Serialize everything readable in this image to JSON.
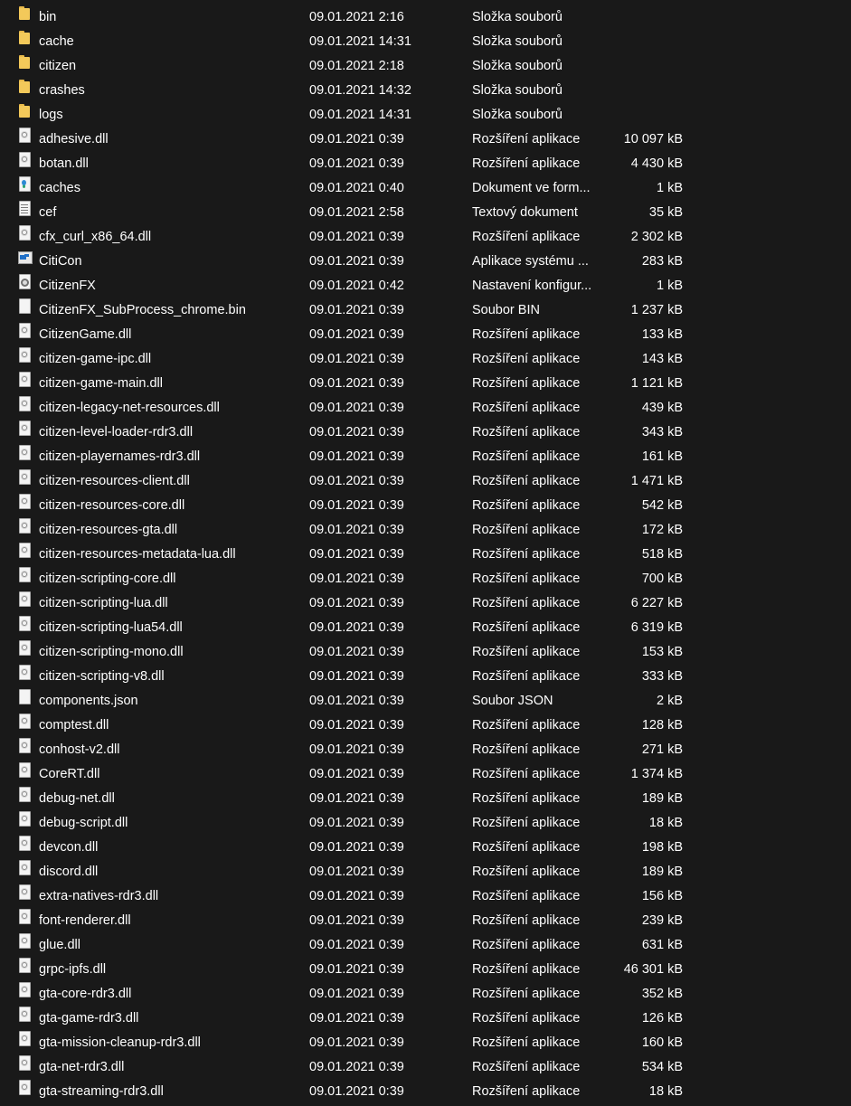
{
  "files": [
    {
      "name": "bin",
      "date": "09.01.2021 2:16",
      "type": "Složka souborů",
      "size": "",
      "icon": "folder"
    },
    {
      "name": "cache",
      "date": "09.01.2021 14:31",
      "type": "Složka souborů",
      "size": "",
      "icon": "folder"
    },
    {
      "name": "citizen",
      "date": "09.01.2021 2:18",
      "type": "Složka souborů",
      "size": "",
      "icon": "folder"
    },
    {
      "name": "crashes",
      "date": "09.01.2021 14:32",
      "type": "Složka souborů",
      "size": "",
      "icon": "folder"
    },
    {
      "name": "logs",
      "date": "09.01.2021 14:31",
      "type": "Složka souborů",
      "size": "",
      "icon": "folder"
    },
    {
      "name": "adhesive.dll",
      "date": "09.01.2021 0:39",
      "type": "Rozšíření aplikace",
      "size": "10 097 kB",
      "icon": "dll"
    },
    {
      "name": "botan.dll",
      "date": "09.01.2021 0:39",
      "type": "Rozšíření aplikace",
      "size": "4 430 kB",
      "icon": "dll"
    },
    {
      "name": "caches",
      "date": "09.01.2021 0:40",
      "type": "Dokument ve form...",
      "size": "1 kB",
      "icon": "doc"
    },
    {
      "name": "cef",
      "date": "09.01.2021 2:58",
      "type": "Textový dokument",
      "size": "35 kB",
      "icon": "txt"
    },
    {
      "name": "cfx_curl_x86_64.dll",
      "date": "09.01.2021 0:39",
      "type": "Rozšíření aplikace",
      "size": "2 302 kB",
      "icon": "dll"
    },
    {
      "name": "CitiCon",
      "date": "09.01.2021 0:39",
      "type": "Aplikace systému ...",
      "size": "283 kB",
      "icon": "exe"
    },
    {
      "name": "CitizenFX",
      "date": "09.01.2021 0:42",
      "type": "Nastavení konfigur...",
      "size": "1 kB",
      "icon": "settings"
    },
    {
      "name": "CitizenFX_SubProcess_chrome.bin",
      "date": "09.01.2021 0:39",
      "type": "Soubor BIN",
      "size": "1 237 kB",
      "icon": "blank"
    },
    {
      "name": "CitizenGame.dll",
      "date": "09.01.2021 0:39",
      "type": "Rozšíření aplikace",
      "size": "133 kB",
      "icon": "dll"
    },
    {
      "name": "citizen-game-ipc.dll",
      "date": "09.01.2021 0:39",
      "type": "Rozšíření aplikace",
      "size": "143 kB",
      "icon": "dll"
    },
    {
      "name": "citizen-game-main.dll",
      "date": "09.01.2021 0:39",
      "type": "Rozšíření aplikace",
      "size": "1 121 kB",
      "icon": "dll"
    },
    {
      "name": "citizen-legacy-net-resources.dll",
      "date": "09.01.2021 0:39",
      "type": "Rozšíření aplikace",
      "size": "439 kB",
      "icon": "dll"
    },
    {
      "name": "citizen-level-loader-rdr3.dll",
      "date": "09.01.2021 0:39",
      "type": "Rozšíření aplikace",
      "size": "343 kB",
      "icon": "dll"
    },
    {
      "name": "citizen-playernames-rdr3.dll",
      "date": "09.01.2021 0:39",
      "type": "Rozšíření aplikace",
      "size": "161 kB",
      "icon": "dll"
    },
    {
      "name": "citizen-resources-client.dll",
      "date": "09.01.2021 0:39",
      "type": "Rozšíření aplikace",
      "size": "1 471 kB",
      "icon": "dll"
    },
    {
      "name": "citizen-resources-core.dll",
      "date": "09.01.2021 0:39",
      "type": "Rozšíření aplikace",
      "size": "542 kB",
      "icon": "dll"
    },
    {
      "name": "citizen-resources-gta.dll",
      "date": "09.01.2021 0:39",
      "type": "Rozšíření aplikace",
      "size": "172 kB",
      "icon": "dll"
    },
    {
      "name": "citizen-resources-metadata-lua.dll",
      "date": "09.01.2021 0:39",
      "type": "Rozšíření aplikace",
      "size": "518 kB",
      "icon": "dll"
    },
    {
      "name": "citizen-scripting-core.dll",
      "date": "09.01.2021 0:39",
      "type": "Rozšíření aplikace",
      "size": "700 kB",
      "icon": "dll"
    },
    {
      "name": "citizen-scripting-lua.dll",
      "date": "09.01.2021 0:39",
      "type": "Rozšíření aplikace",
      "size": "6 227 kB",
      "icon": "dll"
    },
    {
      "name": "citizen-scripting-lua54.dll",
      "date": "09.01.2021 0:39",
      "type": "Rozšíření aplikace",
      "size": "6 319 kB",
      "icon": "dll"
    },
    {
      "name": "citizen-scripting-mono.dll",
      "date": "09.01.2021 0:39",
      "type": "Rozšíření aplikace",
      "size": "153 kB",
      "icon": "dll"
    },
    {
      "name": "citizen-scripting-v8.dll",
      "date": "09.01.2021 0:39",
      "type": "Rozšíření aplikace",
      "size": "333 kB",
      "icon": "dll"
    },
    {
      "name": "components.json",
      "date": "09.01.2021 0:39",
      "type": "Soubor JSON",
      "size": "2 kB",
      "icon": "blank"
    },
    {
      "name": "comptest.dll",
      "date": "09.01.2021 0:39",
      "type": "Rozšíření aplikace",
      "size": "128 kB",
      "icon": "dll"
    },
    {
      "name": "conhost-v2.dll",
      "date": "09.01.2021 0:39",
      "type": "Rozšíření aplikace",
      "size": "271 kB",
      "icon": "dll"
    },
    {
      "name": "CoreRT.dll",
      "date": "09.01.2021 0:39",
      "type": "Rozšíření aplikace",
      "size": "1 374 kB",
      "icon": "dll"
    },
    {
      "name": "debug-net.dll",
      "date": "09.01.2021 0:39",
      "type": "Rozšíření aplikace",
      "size": "189 kB",
      "icon": "dll"
    },
    {
      "name": "debug-script.dll",
      "date": "09.01.2021 0:39",
      "type": "Rozšíření aplikace",
      "size": "18 kB",
      "icon": "dll"
    },
    {
      "name": "devcon.dll",
      "date": "09.01.2021 0:39",
      "type": "Rozšíření aplikace",
      "size": "198 kB",
      "icon": "dll"
    },
    {
      "name": "discord.dll",
      "date": "09.01.2021 0:39",
      "type": "Rozšíření aplikace",
      "size": "189 kB",
      "icon": "dll"
    },
    {
      "name": "extra-natives-rdr3.dll",
      "date": "09.01.2021 0:39",
      "type": "Rozšíření aplikace",
      "size": "156 kB",
      "icon": "dll"
    },
    {
      "name": "font-renderer.dll",
      "date": "09.01.2021 0:39",
      "type": "Rozšíření aplikace",
      "size": "239 kB",
      "icon": "dll"
    },
    {
      "name": "glue.dll",
      "date": "09.01.2021 0:39",
      "type": "Rozšíření aplikace",
      "size": "631 kB",
      "icon": "dll"
    },
    {
      "name": "grpc-ipfs.dll",
      "date": "09.01.2021 0:39",
      "type": "Rozšíření aplikace",
      "size": "46 301 kB",
      "icon": "dll"
    },
    {
      "name": "gta-core-rdr3.dll",
      "date": "09.01.2021 0:39",
      "type": "Rozšíření aplikace",
      "size": "352 kB",
      "icon": "dll"
    },
    {
      "name": "gta-game-rdr3.dll",
      "date": "09.01.2021 0:39",
      "type": "Rozšíření aplikace",
      "size": "126 kB",
      "icon": "dll"
    },
    {
      "name": "gta-mission-cleanup-rdr3.dll",
      "date": "09.01.2021 0:39",
      "type": "Rozšíření aplikace",
      "size": "160 kB",
      "icon": "dll"
    },
    {
      "name": "gta-net-rdr3.dll",
      "date": "09.01.2021 0:39",
      "type": "Rozšíření aplikace",
      "size": "534 kB",
      "icon": "dll"
    },
    {
      "name": "gta-streaming-rdr3.dll",
      "date": "09.01.2021 0:39",
      "type": "Rozšíření aplikace",
      "size": "18 kB",
      "icon": "dll"
    }
  ]
}
